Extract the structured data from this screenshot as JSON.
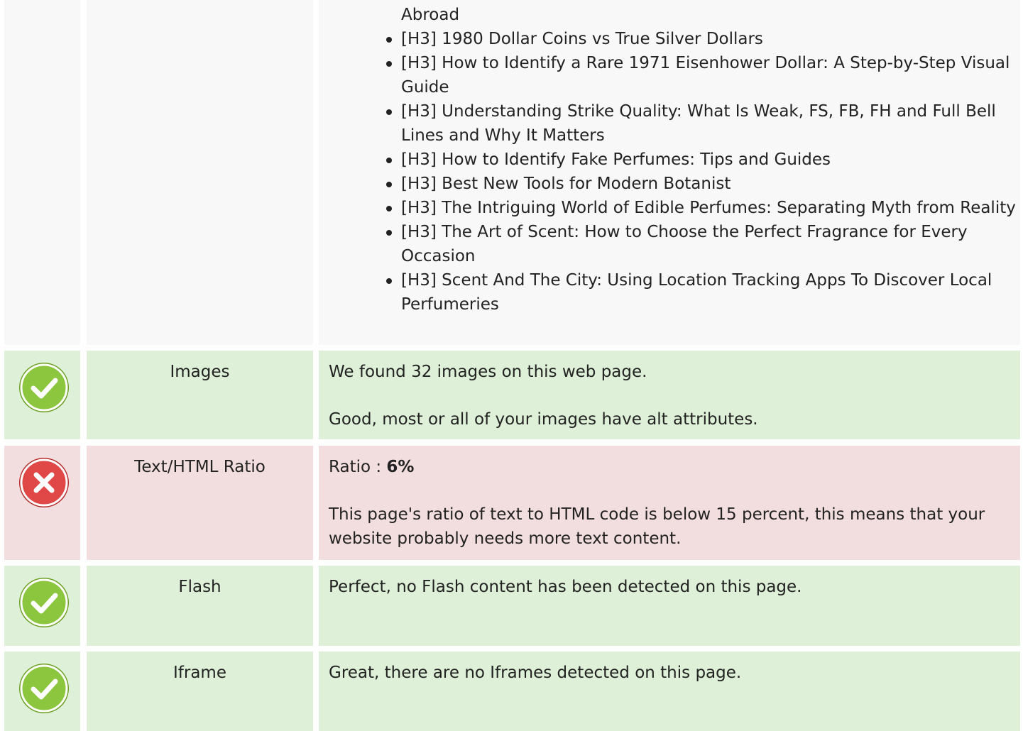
{
  "headings": {
    "continuation": "Abroad",
    "items": [
      "[H3] 1980 Dollar Coins vs True Silver Dollars",
      "[H3] How to Identify a Rare 1971 Eisenhower Dollar: A Step-by-Step Visual Guide",
      "[H3] Understanding Strike Quality: What Is Weak, FS, FB, FH and Full Bell Lines and Why It Matters",
      "[H3] How to Identify Fake Perfumes: Tips and Guides",
      "[H3] Best New Tools for Modern Botanist",
      "[H3] The Intriguing World of Edible Perfumes: Separating Myth from Reality",
      "[H3] The Art of Scent: How to Choose the Perfect Fragrance for Every Occasion",
      "[H3] Scent And The City: Using Location Tracking Apps To Discover Local Perfumeries"
    ]
  },
  "checks": {
    "images": {
      "status": "pass",
      "label": "Images",
      "line1": "We found 32 images on this web page.",
      "line2": "Good, most or all of your images have alt attributes."
    },
    "ratio": {
      "status": "fail",
      "label": "Text/HTML Ratio",
      "prefix": "Ratio : ",
      "value": "6%",
      "line2": "This page's ratio of text to HTML code is below 15 percent, this means that your website probably needs more text content."
    },
    "flash": {
      "status": "pass",
      "label": "Flash",
      "line1": "Perfect, no Flash content has been detected on this page."
    },
    "iframe": {
      "status": "pass",
      "label": "Iframe",
      "line1": "Great, there are no Iframes detected on this page."
    }
  },
  "colors": {
    "pass_bg": "#dff0d8",
    "fail_bg": "#f2dede",
    "pass_icon": "#8cc63f",
    "fail_icon": "#e04848"
  }
}
